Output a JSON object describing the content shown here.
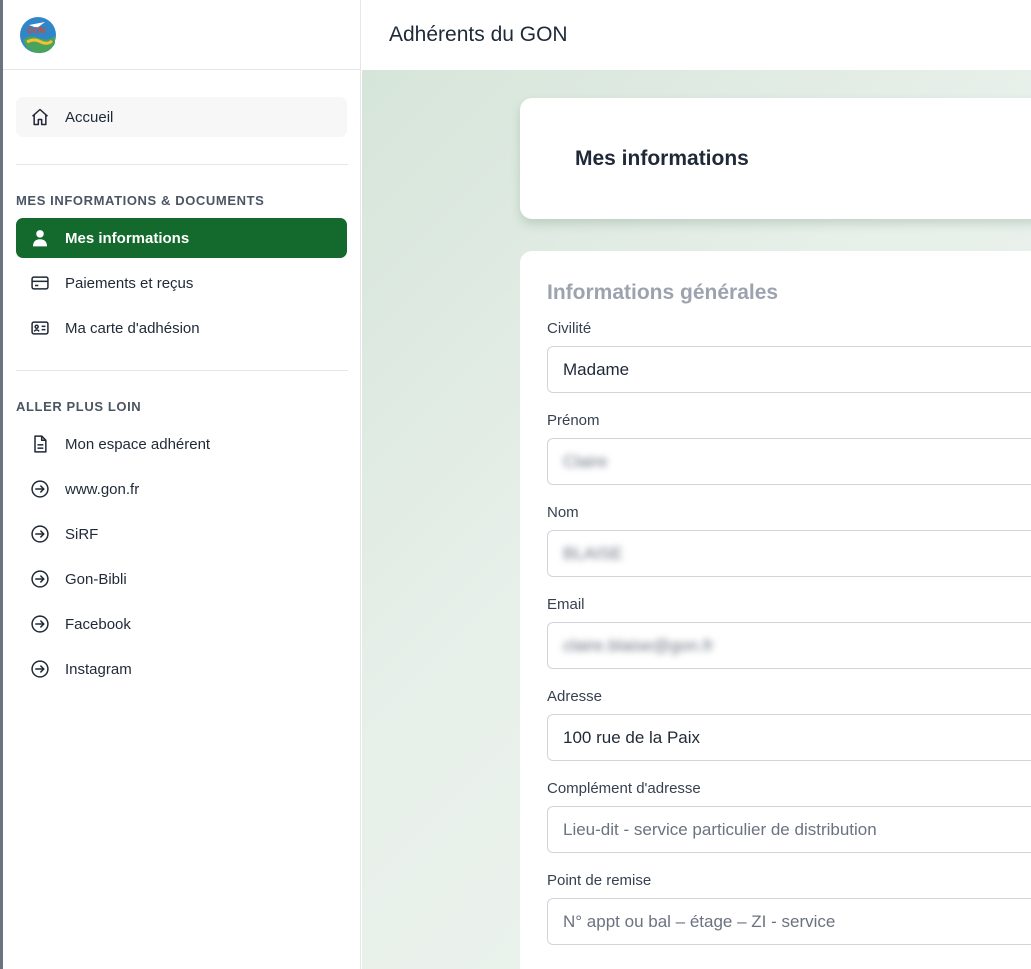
{
  "header": {
    "title": "Adhérents du GON"
  },
  "logo": {
    "text": "GON"
  },
  "sidebar": {
    "home": {
      "label": "Accueil",
      "icon": "home-icon"
    },
    "section1": {
      "title": "MES INFORMATIONS & DOCUMENTS",
      "items": [
        {
          "label": "Mes informations",
          "icon": "user-icon",
          "active": true
        },
        {
          "label": "Paiements et reçus",
          "icon": "credit-card-icon"
        },
        {
          "label": "Ma carte d'adhésion",
          "icon": "id-card-icon"
        }
      ]
    },
    "section2": {
      "title": "ALLER PLUS LOIN",
      "items": [
        {
          "label": "Mon espace adhérent",
          "icon": "document-icon"
        },
        {
          "label": "www.gon.fr",
          "icon": "arrow-right-circle-icon"
        },
        {
          "label": "SiRF",
          "icon": "arrow-right-circle-icon"
        },
        {
          "label": "Gon-Bibli",
          "icon": "arrow-right-circle-icon"
        },
        {
          "label": "Facebook",
          "icon": "arrow-right-circle-icon"
        },
        {
          "label": "Instagram",
          "icon": "arrow-right-circle-icon"
        }
      ]
    }
  },
  "main": {
    "page_title": "Mes informations",
    "form": {
      "heading": "Informations générales",
      "fields": [
        {
          "label": "Civilité",
          "value": "Madame",
          "placeholder": ""
        },
        {
          "label": "Prénom",
          "value": "Claire",
          "placeholder": ""
        },
        {
          "label": "Nom",
          "value": "BLAISE",
          "placeholder": ""
        },
        {
          "label": "Email",
          "value": "claire.blaise@gon.fr",
          "placeholder": ""
        },
        {
          "label": "Adresse",
          "value": "100 rue de la Paix",
          "placeholder": ""
        },
        {
          "label": "Complément d'adresse",
          "value": "",
          "placeholder": "Lieu-dit - service particulier de distribution"
        },
        {
          "label": "Point de remise",
          "value": "",
          "placeholder": "N° appt ou bal – étage – ZI - service"
        }
      ]
    }
  },
  "colors": {
    "accent": "#136a2c",
    "background_tint": "#dfeae2"
  }
}
